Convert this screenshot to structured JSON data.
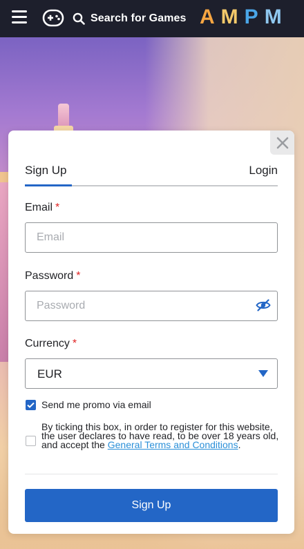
{
  "header": {
    "menu_icon": "hamburger-icon",
    "games_icon": "gamepad-icon",
    "search_icon": "search-icon",
    "search_label": "Search for Games",
    "logo_letters": [
      {
        "char": "A",
        "color": "#f6a542"
      },
      {
        "char": "M",
        "color": "#f3c96a"
      },
      {
        "char": "P",
        "color": "#4aa6e8"
      },
      {
        "char": "M",
        "color": "#8fc7ef"
      }
    ]
  },
  "modal": {
    "close_icon": "close-icon",
    "tabs": [
      {
        "label": "Sign Up",
        "active": true
      },
      {
        "label": "Login",
        "active": false
      }
    ],
    "email": {
      "label": "Email",
      "required_mark": "*",
      "placeholder": "Email",
      "value": ""
    },
    "password": {
      "label": "Password",
      "required_mark": "*",
      "placeholder": "Password",
      "value": "",
      "toggle_icon": "eye-slash-icon"
    },
    "currency": {
      "label": "Currency",
      "required_mark": "*",
      "selected": "EUR",
      "arrow_icon": "caret-down-icon"
    },
    "promo": {
      "label": "Send me promo via email",
      "checked": true
    },
    "terms": {
      "text": "By ticking this box, in order to register for this website, the user declares to have read, to be over 18 years old, and accept the ",
      "link": "General Terms and Conditions",
      "suffix": ".",
      "checked": false
    },
    "submit_label": "Sign Up"
  },
  "colors": {
    "accent": "#2366c6",
    "topbar": "#1d1f2c",
    "required": "#e02424",
    "link": "#2a8fd8"
  }
}
